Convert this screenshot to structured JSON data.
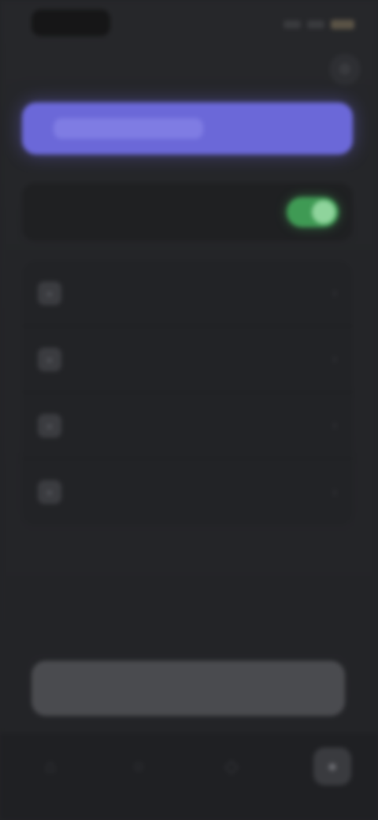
{
  "status_bar": {
    "time": "",
    "signal_icon": "signal-icon",
    "wifi_icon": "wifi-icon",
    "battery_icon": "battery-icon"
  },
  "header": {
    "title": "",
    "action_icon": "gear-icon"
  },
  "primary_banner": {
    "label": "",
    "accent_color": "#6b68d8"
  },
  "toggle_row": {
    "label": "",
    "state": "on",
    "on_color": "#3f9a54"
  },
  "list": {
    "items": [
      {
        "icon": "person-icon",
        "label": ""
      },
      {
        "icon": "bell-icon",
        "label": ""
      },
      {
        "icon": "lock-icon",
        "label": ""
      },
      {
        "icon": "info-icon",
        "label": ""
      }
    ]
  },
  "bottom_button": {
    "label": ""
  },
  "tab_bar": {
    "tabs": [
      {
        "icon": "home-icon"
      },
      {
        "icon": "search-icon"
      },
      {
        "icon": "chat-icon"
      },
      {
        "icon": "profile-icon",
        "active": true
      }
    ]
  }
}
